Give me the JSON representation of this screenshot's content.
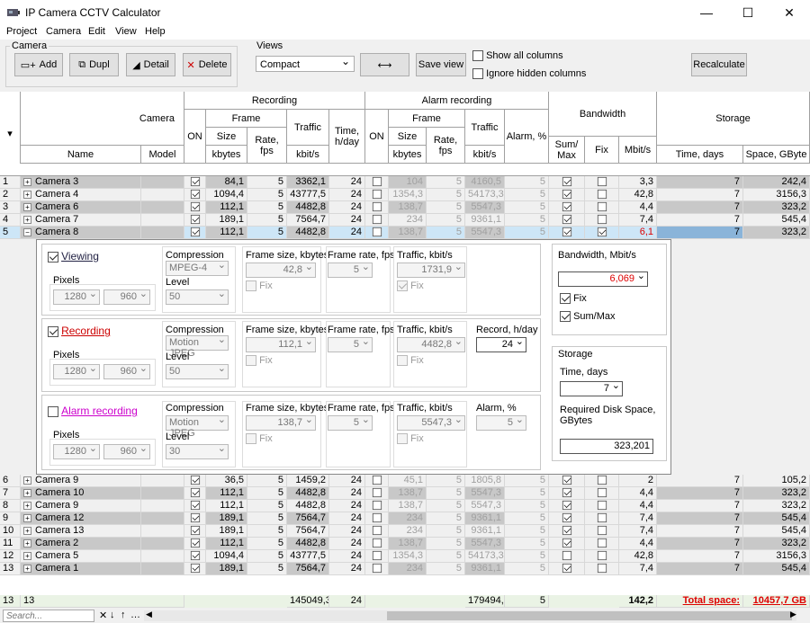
{
  "window": {
    "title": "IP Camera CCTV Calculator"
  },
  "menu": [
    "Project",
    "Camera",
    "Edit",
    "View",
    "Help"
  ],
  "toolbar": {
    "camera_group": "Camera",
    "add": "Add",
    "dupl": "Dupl",
    "detail": "Detail",
    "delete": "Delete",
    "views_group": "Views",
    "view_value": "Compact",
    "save_view": "Save view",
    "show_all": "Show all columns",
    "ignore_hidden": "Ignore hidden columns",
    "recalculate": "Recalculate"
  },
  "headers": {
    "camera": "Camera",
    "name": "Name",
    "model": "Model",
    "on": "ON",
    "recording": "Recording",
    "alarm_recording": "Alarm recording",
    "frame": "Frame",
    "size": "Size",
    "kbytes": "kbytes",
    "rate": "Rate, fps",
    "traffic": "Traffic",
    "kbits": "kbit/s",
    "time_day": "Time, h/day",
    "alarm_pct": "Alarm, %",
    "bandwidth": "Bandwidth",
    "summax": "Sum/ Max",
    "fix": "Fix",
    "mbits": "Mbit/s",
    "storage": "Storage",
    "time_days": "Time, days",
    "space": "Space, GByte"
  },
  "rows_top": [
    {
      "n": "1",
      "name": "Camera 3",
      "size": "84,1",
      "rate": "5",
      "traffic": "3362,1",
      "time": "24",
      "asize": "104",
      "arate": "5",
      "atraffic": "4160,5",
      "alarm": "5",
      "sum": true,
      "fix": false,
      "mbit": "3,3",
      "days": "7",
      "space": "242,4",
      "g": true
    },
    {
      "n": "2",
      "name": "Camera 4",
      "size": "1094,4",
      "rate": "5",
      "traffic": "43777,5",
      "time": "24",
      "asize": "1354,3",
      "arate": "5",
      "atraffic": "54173,3",
      "alarm": "5",
      "sum": true,
      "fix": false,
      "mbit": "42,8",
      "days": "7",
      "space": "3156,3",
      "g": false
    },
    {
      "n": "3",
      "name": "Camera 6",
      "size": "112,1",
      "rate": "5",
      "traffic": "4482,8",
      "time": "24",
      "asize": "138,7",
      "arate": "5",
      "atraffic": "5547,3",
      "alarm": "5",
      "sum": true,
      "fix": false,
      "mbit": "4,4",
      "days": "7",
      "space": "323,2",
      "g": true
    },
    {
      "n": "4",
      "name": "Camera 7",
      "size": "189,1",
      "rate": "5",
      "traffic": "7564,7",
      "time": "24",
      "asize": "234",
      "arate": "5",
      "atraffic": "9361,1",
      "alarm": "5",
      "sum": true,
      "fix": false,
      "mbit": "7,4",
      "days": "7",
      "space": "545,4",
      "g": false
    },
    {
      "n": "5",
      "name": "Camera 8",
      "size": "112,1",
      "rate": "5",
      "traffic": "4482,8",
      "time": "24",
      "asize": "138,7",
      "arate": "5",
      "atraffic": "5547,3",
      "alarm": "5",
      "sum": true,
      "fix": true,
      "mbit": "6,1",
      "days": "7",
      "space": "323,2",
      "g": true,
      "sel": true
    }
  ],
  "rows_bottom": [
    {
      "n": "6",
      "name": "Camera 9",
      "size": "36,5",
      "rate": "5",
      "traffic": "1459,2",
      "time": "24",
      "asize": "45,1",
      "arate": "5",
      "atraffic": "1805,8",
      "alarm": "5",
      "sum": true,
      "fix": false,
      "mbit": "2",
      "days": "7",
      "space": "105,2",
      "g": false
    },
    {
      "n": "7",
      "name": "Camera 10",
      "size": "112,1",
      "rate": "5",
      "traffic": "4482,8",
      "time": "24",
      "asize": "138,7",
      "arate": "5",
      "atraffic": "5547,3",
      "alarm": "5",
      "sum": true,
      "fix": false,
      "mbit": "4,4",
      "days": "7",
      "space": "323,2",
      "g": true
    },
    {
      "n": "8",
      "name": "Camera 9",
      "size": "112,1",
      "rate": "5",
      "traffic": "4482,8",
      "time": "24",
      "asize": "138,7",
      "arate": "5",
      "atraffic": "5547,3",
      "alarm": "5",
      "sum": true,
      "fix": false,
      "mbit": "4,4",
      "days": "7",
      "space": "323,2",
      "g": false
    },
    {
      "n": "9",
      "name": "Camera 12",
      "size": "189,1",
      "rate": "5",
      "traffic": "7564,7",
      "time": "24",
      "asize": "234",
      "arate": "5",
      "atraffic": "9361,1",
      "alarm": "5",
      "sum": true,
      "fix": false,
      "mbit": "7,4",
      "days": "7",
      "space": "545,4",
      "g": true
    },
    {
      "n": "10",
      "name": "Camera 13",
      "size": "189,1",
      "rate": "5",
      "traffic": "7564,7",
      "time": "24",
      "asize": "234",
      "arate": "5",
      "atraffic": "9361,1",
      "alarm": "5",
      "sum": true,
      "fix": false,
      "mbit": "7,4",
      "days": "7",
      "space": "545,4",
      "g": false
    },
    {
      "n": "11",
      "name": "Camera 2",
      "size": "112,1",
      "rate": "5",
      "traffic": "4482,8",
      "time": "24",
      "asize": "138,7",
      "arate": "5",
      "atraffic": "5547,3",
      "alarm": "5",
      "sum": true,
      "fix": false,
      "mbit": "4,4",
      "days": "7",
      "space": "323,2",
      "g": true
    },
    {
      "n": "12",
      "name": "Camera 5",
      "size": "1094,4",
      "rate": "5",
      "traffic": "43777,5",
      "time": "24",
      "asize": "1354,3",
      "arate": "5",
      "atraffic": "54173,3",
      "alarm": "5",
      "sum": false,
      "fix": false,
      "mbit": "42,8",
      "days": "7",
      "space": "3156,3",
      "g": false
    },
    {
      "n": "13",
      "name": "Camera 1",
      "size": "189,1",
      "rate": "5",
      "traffic": "7564,7",
      "time": "24",
      "asize": "234",
      "arate": "5",
      "atraffic": "9361,1",
      "alarm": "5",
      "sum": true,
      "fix": false,
      "mbit": "7,4",
      "days": "7",
      "space": "545,4",
      "g": true
    }
  ],
  "detail": {
    "viewing": "Viewing",
    "recording": "Recording",
    "alarm_recording": "Alarm recording",
    "pixels": "Pixels",
    "compression": "Compression",
    "level": "Level",
    "frame_size": "Frame size, kbytes",
    "frame_rate": "Frame rate, fps",
    "traffic": "Traffic, kbit/s",
    "record_hday": "Record, h/day",
    "alarm_pct": "Alarm, %",
    "fix": "Fix",
    "v": {
      "w": "1280",
      "h": "960",
      "comp": "MPEG-4",
      "level": "50",
      "size": "42,8",
      "rate": "5",
      "traffic": "1731,9"
    },
    "r": {
      "w": "1280",
      "h": "960",
      "comp": "Motion JPEG",
      "level": "50",
      "size": "112,1",
      "rate": "5",
      "traffic": "4482,8",
      "hday": "24"
    },
    "a": {
      "w": "1280",
      "h": "960",
      "comp": "Motion JPEG",
      "level": "30",
      "size": "138,7",
      "rate": "5",
      "traffic": "5547,3",
      "alarm": "5"
    },
    "bandwidth_title": "Bandwidth, Mbit/s",
    "bandwidth_value": "6,069",
    "summax": "Sum/Max",
    "storage": "Storage",
    "time_days": "Time, days",
    "time_value": "7",
    "required": "Required Disk Space, GBytes",
    "required_value": "323,201"
  },
  "footer": {
    "n": "13",
    "count": "13",
    "traffic": "145049,3",
    "time": "24",
    "atraffic": "179494,1",
    "alarm": "5",
    "mbit": "142,2",
    "total_label": "Total space:",
    "total_value": "10457,7 GB"
  },
  "search": {
    "placeholder": "Search..."
  }
}
